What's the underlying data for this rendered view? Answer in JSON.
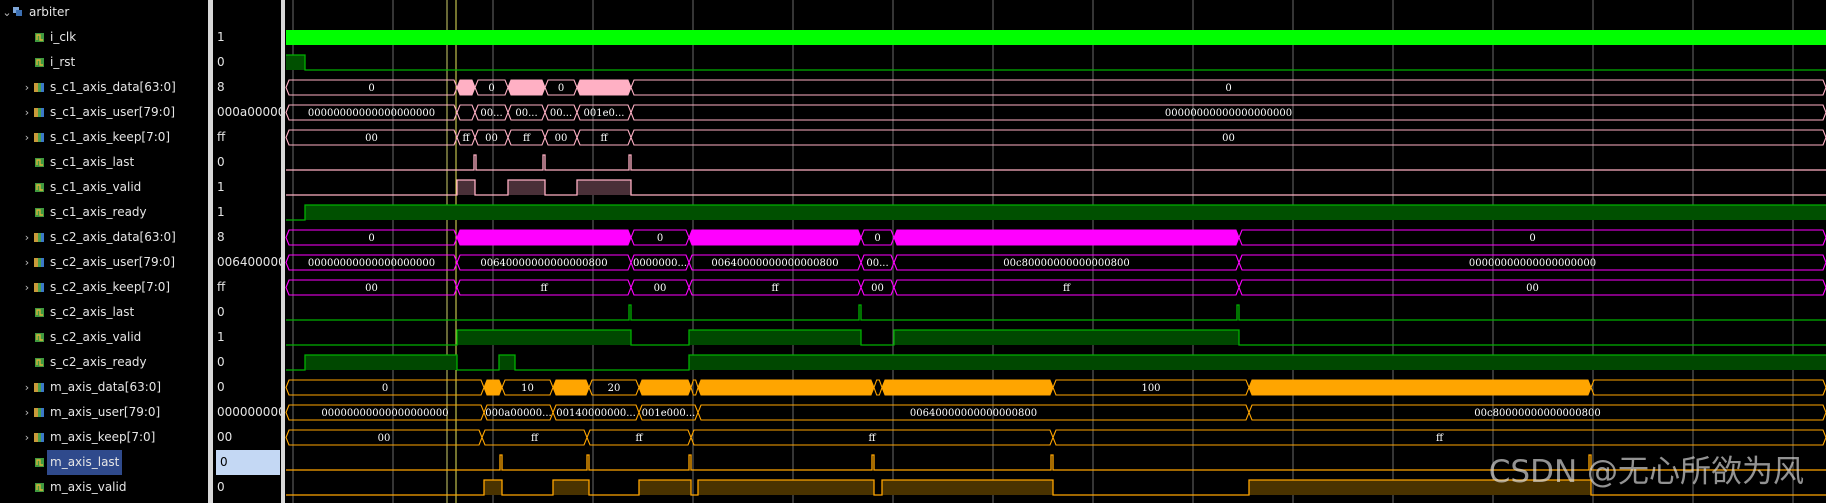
{
  "scope": {
    "name": "arbiter",
    "icon": "module-icon"
  },
  "colors": {
    "clk": "#00ff00",
    "c1": "#ffb0c4",
    "c2": "#ff00ff",
    "m": "#ffa500",
    "ctrl": "#00b000",
    "grid": "#6a6a6a",
    "cursor": "#e8e85a"
  },
  "signals": [
    {
      "name": "i_clk",
      "value": "1",
      "type": "bit"
    },
    {
      "name": "i_rst",
      "value": "0",
      "type": "bit"
    },
    {
      "name": "s_c1_axis_data[63:0]",
      "value": "8",
      "type": "bus"
    },
    {
      "name": "s_c1_axis_user[79:0]",
      "value": "000a00000",
      "type": "bus"
    },
    {
      "name": "s_c1_axis_keep[7:0]",
      "value": "ff",
      "type": "bus"
    },
    {
      "name": "s_c1_axis_last",
      "value": "0",
      "type": "bit"
    },
    {
      "name": "s_c1_axis_valid",
      "value": "1",
      "type": "bit"
    },
    {
      "name": "s_c1_axis_ready",
      "value": "1",
      "type": "bit"
    },
    {
      "name": "s_c2_axis_data[63:0]",
      "value": "8",
      "type": "bus"
    },
    {
      "name": "s_c2_axis_user[79:0]",
      "value": "006400000",
      "type": "bus"
    },
    {
      "name": "s_c2_axis_keep[7:0]",
      "value": "ff",
      "type": "bus"
    },
    {
      "name": "s_c2_axis_last",
      "value": "0",
      "type": "bit"
    },
    {
      "name": "s_c2_axis_valid",
      "value": "1",
      "type": "bit"
    },
    {
      "name": "s_c2_axis_ready",
      "value": "0",
      "type": "bit"
    },
    {
      "name": "m_axis_data[63:0]",
      "value": "0",
      "type": "bus"
    },
    {
      "name": "m_axis_user[79:0]",
      "value": "000000000",
      "type": "bus"
    },
    {
      "name": "m_axis_keep[7:0]",
      "value": "00",
      "type": "bus"
    },
    {
      "name": "m_axis_last",
      "value": "0",
      "type": "bit",
      "selected": true
    },
    {
      "name": "m_axis_valid",
      "value": "0",
      "type": "bit"
    }
  ],
  "bus_segment_labels": {
    "s_c1_axis_data": [
      "0",
      "0",
      "0",
      "0"
    ],
    "s_c1_axis_user": [
      "00000000000000000000",
      "00...",
      "00...",
      "00...",
      "001e0...",
      "00000000000000000000"
    ],
    "s_c1_axis_keep": [
      "00",
      "ff",
      "00",
      "ff",
      "00",
      "ff",
      "00"
    ],
    "s_c2_axis_data": [
      "0",
      "0",
      "0",
      "0"
    ],
    "s_c2_axis_user": [
      "00000000000000000000",
      "00640000000000000800",
      "0000000...",
      "00640000000000000800",
      "00...",
      "00c80000000000000800",
      "00000000000000000000"
    ],
    "s_c2_axis_keep": [
      "00",
      "ff",
      "00",
      "ff",
      "00",
      "ff",
      "00"
    ],
    "m_axis_data": [
      "0",
      "10",
      "20",
      "100"
    ],
    "m_axis_user": [
      "00000000000000000000",
      "000a00000...",
      "00140000000...",
      "001e000...",
      "00640000000000000800",
      "00c80000000000000800"
    ],
    "m_axis_keep": [
      "00",
      "ff",
      "ff",
      "ff",
      "ff"
    ]
  },
  "watermark": "CSDN @无心所欲为风"
}
